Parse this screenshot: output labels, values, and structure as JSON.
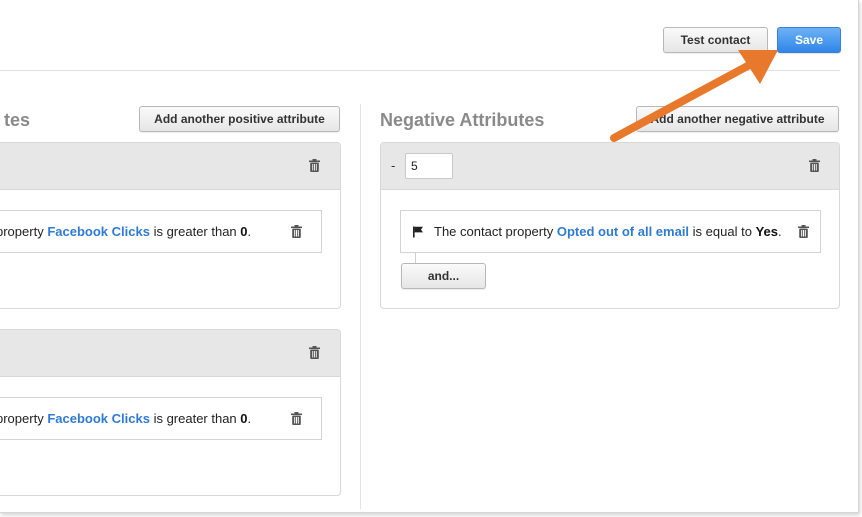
{
  "toolbar": {
    "test_contact_label": "Test contact",
    "save_label": "Save"
  },
  "positive": {
    "heading": "tes",
    "add_label": "Add another positive attribute",
    "groups": [
      {
        "condition": {
          "prefix": "property",
          "property": "Facebook Clicks",
          "operator": "is greater than",
          "value": "0",
          "suffix": "."
        }
      },
      {
        "condition": {
          "prefix": "property",
          "property": "Facebook Clicks",
          "operator": "is greater than",
          "value": "0",
          "suffix": "."
        }
      }
    ]
  },
  "negative": {
    "heading": "Negative Attributes",
    "add_label": "Add another negative attribute",
    "groups": [
      {
        "sign": "-",
        "score": "5",
        "condition": {
          "prefix": "The contact property",
          "property": "Opted out of all email",
          "operator": "is equal to",
          "value": "Yes",
          "suffix": "."
        },
        "and_label": "and..."
      }
    ]
  },
  "icons": {
    "trash": "trash-icon",
    "flag": "flag-icon",
    "arrow": "orange-arrow-annotation"
  },
  "colors": {
    "link": "#2f7bd4",
    "save": "#2f86e8",
    "arrow": "#e8782b",
    "panel_header": "#e7e7e7"
  }
}
